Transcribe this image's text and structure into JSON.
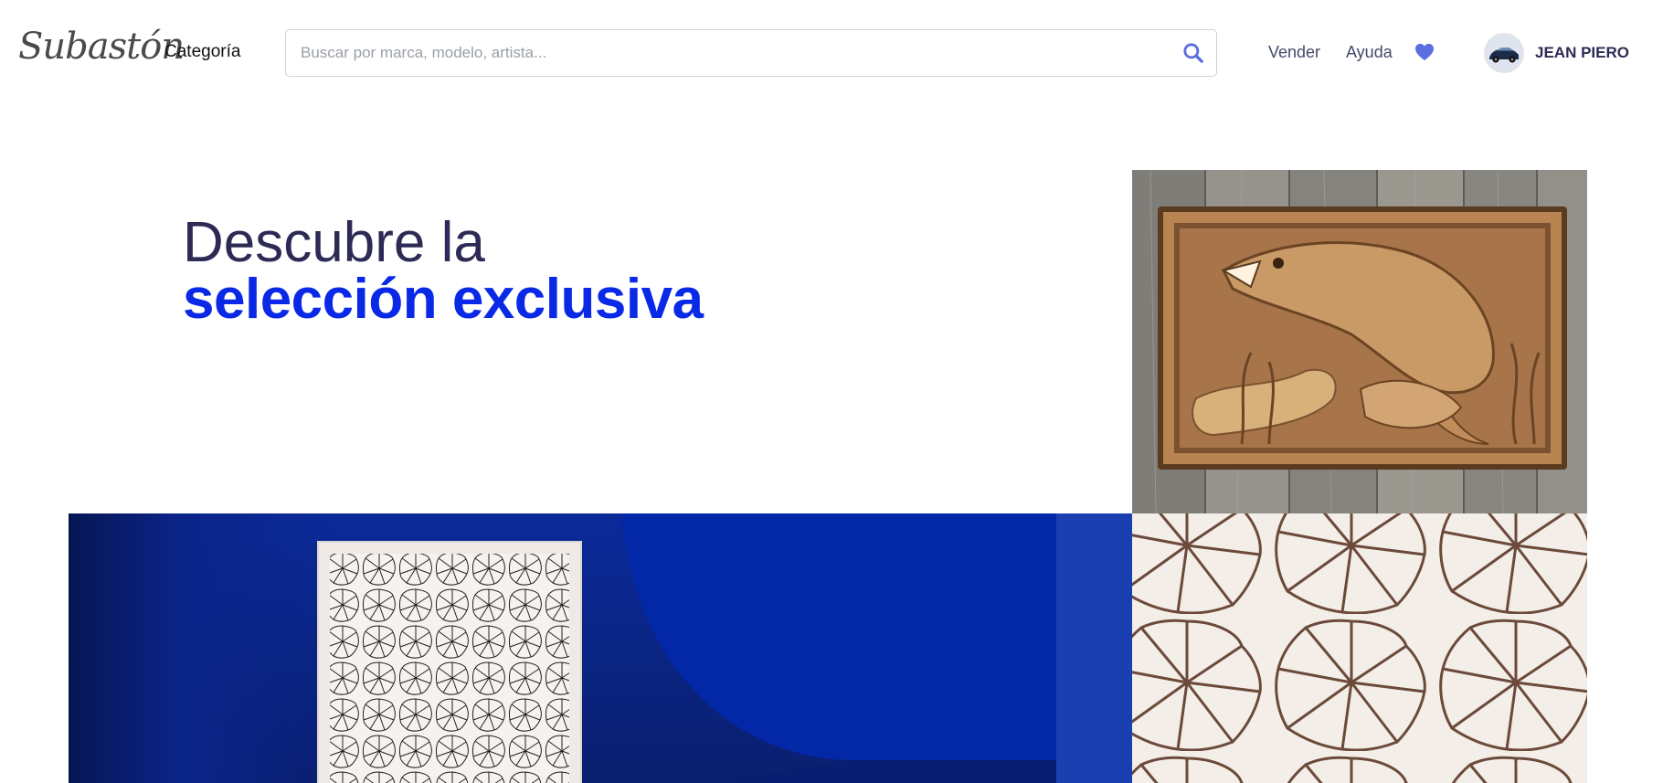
{
  "header": {
    "logo": "Subastón",
    "category_label": "Categoría",
    "search_placeholder": "Buscar por marca, modelo, artista...",
    "nav": {
      "sell": "Vender",
      "help": "Ayuda"
    },
    "user_name": "JEAN PIERO",
    "icons": {
      "search": "search-icon",
      "favorites": "heart-icon",
      "avatar": "car-avatar"
    },
    "accent_color": "#5b6ee1"
  },
  "hero": {
    "line1": "Descubre la",
    "line2": "selección exclusiva",
    "line1_color": "#2d2b55",
    "line2_color": "#0a29e6"
  },
  "gallery": {
    "images": [
      "carved-wood-pike-fish-relief",
      "line-art-flower-pattern-on-blue-background",
      "brown-line-art-flower-pattern-closeup"
    ]
  }
}
